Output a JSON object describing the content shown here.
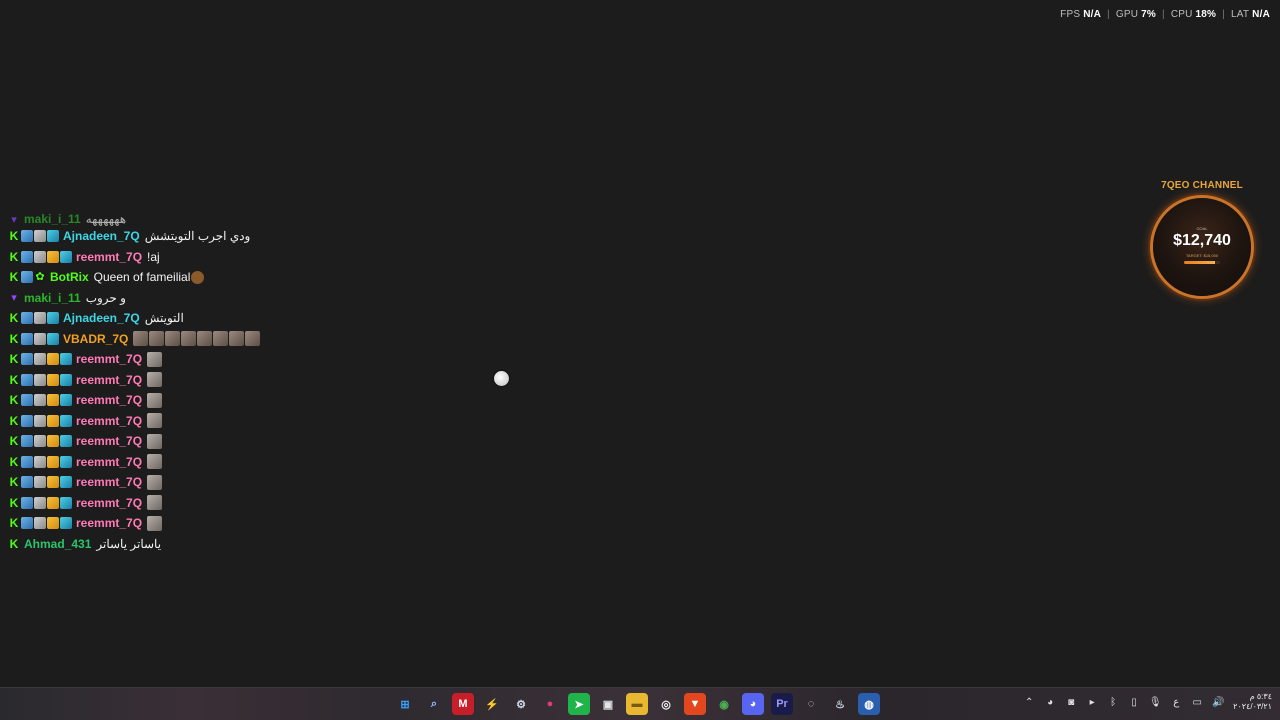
{
  "perf_overlay": {
    "fps_label": "FPS",
    "fps_value": "N/A",
    "gpu_label": "GPU",
    "gpu_value": "7%",
    "cpu_label": "CPU",
    "cpu_value": "18%",
    "lat_label": "LAT",
    "lat_value": "N/A",
    "separator": "|"
  },
  "goal_widget": {
    "title": "7QEO CHANNEL",
    "small_label": "GOAL",
    "amount": "$12,740",
    "target": "TARGET: $15,000",
    "progress_fraction": 0.85,
    "colors": {
      "accent": "#e7a63c",
      "ring": "#c8752a"
    }
  },
  "chat": {
    "messages": [
      {
        "user": "maki_i_11",
        "user_color": "#2bb52b",
        "text": "ههههههه",
        "badges": [
          "twitch"
        ],
        "partial": true
      },
      {
        "user": "Ajnadeen_7Q",
        "user_color": "#3dd6e6",
        "text": "ودي اجرب التويتشش",
        "badges": [
          "kick",
          "pickaxe",
          "gray",
          "blue"
        ]
      },
      {
        "user": "reemmt_7Q",
        "user_color": "#ff7ab6",
        "text": "!aj",
        "badges": [
          "kick",
          "pickaxe",
          "gray",
          "crown",
          "blue"
        ]
      },
      {
        "user": "BotRix",
        "user_color": "#53fc18",
        "text": "Queen of fameilial",
        "badges": [
          "kick",
          "pickaxe",
          "green"
        ],
        "emote": "cookie"
      },
      {
        "user": "maki_i_11",
        "user_color": "#2bb52b",
        "text": "و حروب",
        "badges": [
          "twitch"
        ]
      },
      {
        "user": "Ajnadeen_7Q",
        "user_color": "#3dd6e6",
        "text": "التويتش",
        "badges": [
          "kick",
          "pickaxe",
          "gray",
          "blue"
        ]
      },
      {
        "user": "VBADR_7Q",
        "user_color": "#f0a020",
        "text": "",
        "badges": [
          "kick",
          "pickaxe",
          "gray",
          "blue"
        ],
        "emote_count": 8
      },
      {
        "user": "reemmt_7Q",
        "user_color": "#ff7ab6",
        "text": "",
        "badges": [
          "kick",
          "pickaxe",
          "gray",
          "crown",
          "blue"
        ],
        "emote_count": 1
      },
      {
        "user": "reemmt_7Q",
        "user_color": "#ff7ab6",
        "text": "",
        "badges": [
          "kick",
          "pickaxe",
          "gray",
          "crown",
          "blue"
        ],
        "emote_count": 1
      },
      {
        "user": "reemmt_7Q",
        "user_color": "#ff7ab6",
        "text": "",
        "badges": [
          "kick",
          "pickaxe",
          "gray",
          "crown",
          "blue"
        ],
        "emote_count": 1
      },
      {
        "user": "reemmt_7Q",
        "user_color": "#ff7ab6",
        "text": "",
        "badges": [
          "kick",
          "pickaxe",
          "gray",
          "crown",
          "blue"
        ],
        "emote_count": 1
      },
      {
        "user": "reemmt_7Q",
        "user_color": "#ff7ab6",
        "text": "",
        "badges": [
          "kick",
          "pickaxe",
          "gray",
          "crown",
          "blue"
        ],
        "emote_count": 1
      },
      {
        "user": "reemmt_7Q",
        "user_color": "#ff7ab6",
        "text": "",
        "badges": [
          "kick",
          "pickaxe",
          "gray",
          "crown",
          "blue"
        ],
        "emote_count": 1
      },
      {
        "user": "reemmt_7Q",
        "user_color": "#ff7ab6",
        "text": "",
        "badges": [
          "kick",
          "pickaxe",
          "gray",
          "crown",
          "blue"
        ],
        "emote_count": 1
      },
      {
        "user": "reemmt_7Q",
        "user_color": "#ff7ab6",
        "text": "",
        "badges": [
          "kick",
          "pickaxe",
          "gray",
          "crown",
          "blue"
        ],
        "emote_count": 1
      },
      {
        "user": "reemmt_7Q",
        "user_color": "#ff7ab6",
        "text": "",
        "badges": [
          "kick",
          "pickaxe",
          "gray",
          "crown",
          "blue"
        ],
        "emote_count": 1
      },
      {
        "user": "Ahmad_431",
        "user_color": "#2bc46a",
        "text": "ياساتر ياساتر",
        "badges": [
          "kick"
        ]
      }
    ]
  },
  "taskbar": {
    "apps": [
      {
        "name": "windows-start-icon",
        "glyph": "⊞",
        "bg": "transparent",
        "fg": "#3aa0ff"
      },
      {
        "name": "search-icon",
        "glyph": "⌕",
        "bg": "transparent",
        "fg": "#8fc0ff"
      },
      {
        "name": "app-red-icon",
        "glyph": "M",
        "bg": "#c81e2a",
        "fg": "#fff"
      },
      {
        "name": "lightning-icon",
        "glyph": "⚡",
        "bg": "transparent",
        "fg": "#ffffff"
      },
      {
        "name": "settings-gear-icon",
        "glyph": "⚙",
        "bg": "transparent",
        "fg": "#cfd6e6"
      },
      {
        "name": "pink-app-icon",
        "glyph": "●",
        "bg": "transparent",
        "fg": "#e23a7a"
      },
      {
        "name": "green-send-icon",
        "glyph": "➤",
        "bg": "#1fb34a",
        "fg": "#fff"
      },
      {
        "name": "image-editor-icon",
        "glyph": "▣",
        "bg": "transparent",
        "fg": "#e5e5e5"
      },
      {
        "name": "file-explorer-icon",
        "glyph": "▬",
        "bg": "#e8b830",
        "fg": "#7a5a10"
      },
      {
        "name": "steelseries-icon",
        "glyph": "◎",
        "bg": "transparent",
        "fg": "#f0f0f0"
      },
      {
        "name": "brave-browser-icon",
        "glyph": "▼",
        "bg": "#e2471f",
        "fg": "#fff"
      },
      {
        "name": "chrome-icon",
        "glyph": "◉",
        "bg": "transparent",
        "fg": "#4caf50"
      },
      {
        "name": "discord-icon",
        "glyph": "◕",
        "bg": "#5865f2",
        "fg": "#fff"
      },
      {
        "name": "premiere-pro-icon",
        "glyph": "Pr",
        "bg": "#1b1b4a",
        "fg": "#9999ff"
      },
      {
        "name": "obs-icon",
        "glyph": "◌",
        "bg": "transparent",
        "fg": "#e0e0e0"
      },
      {
        "name": "steam-icon",
        "glyph": "♨",
        "bg": "transparent",
        "fg": "#c7d5e0"
      },
      {
        "name": "active-app-icon",
        "glyph": "◍",
        "bg": "#2a5fb0",
        "fg": "#fff"
      }
    ],
    "tray": {
      "icons": [
        {
          "name": "chevron-up-icon",
          "glyph": "⌃"
        },
        {
          "name": "discord-tray-icon",
          "glyph": "◕"
        },
        {
          "name": "headset-icon",
          "glyph": "◙"
        },
        {
          "name": "play-icon",
          "glyph": "▸"
        },
        {
          "name": "bluetooth-icon",
          "glyph": "ᛒ"
        },
        {
          "name": "battery-icon",
          "glyph": "▯"
        },
        {
          "name": "microphone-icon",
          "glyph": "🎙"
        },
        {
          "name": "language-indicator",
          "glyph": "ع"
        },
        {
          "name": "display-icon",
          "glyph": "▭"
        },
        {
          "name": "volume-icon",
          "glyph": "🔊"
        }
      ],
      "time": "٥:٣٤ م",
      "date": "٢٠٢٤/٠٣/٢١"
    }
  }
}
